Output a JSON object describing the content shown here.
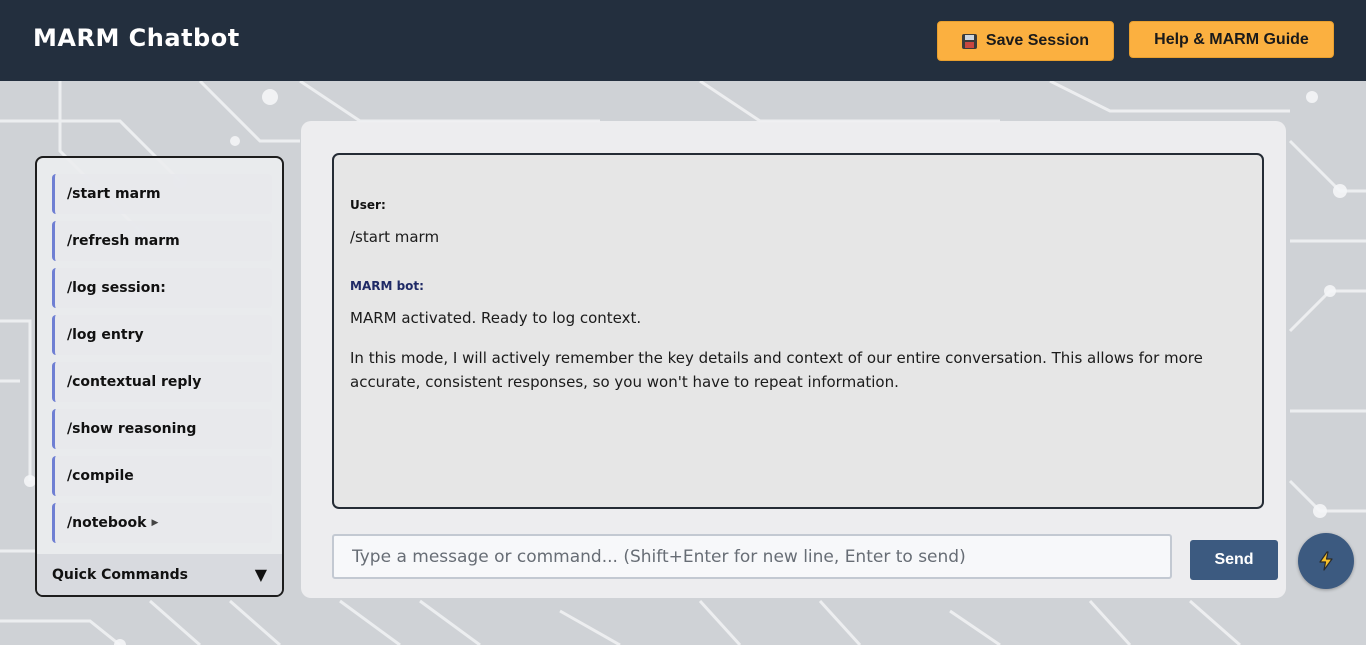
{
  "header": {
    "title": "MARM Chatbot",
    "save_label": "Save Session",
    "help_label": "Help & MARM Guide"
  },
  "sidebar": {
    "items": [
      {
        "label": "/start marm"
      },
      {
        "label": "/refresh marm"
      },
      {
        "label": "/log session:"
      },
      {
        "label": "/log entry"
      },
      {
        "label": "/contextual reply"
      },
      {
        "label": "/show reasoning"
      },
      {
        "label": "/compile"
      },
      {
        "label": "/notebook"
      }
    ],
    "quick_label": "Quick Commands",
    "quick_arrow": "▼",
    "notebook_arrow": "▶"
  },
  "chat": {
    "messages": [
      {
        "sender": "User:",
        "lines": [
          "/start marm"
        ]
      },
      {
        "sender": "MARM bot:",
        "lines": [
          "MARM activated. Ready to log context.",
          "In this mode, I will actively remember the key details and context of our entire conversation. This allows for more accurate, consistent responses, so you won't have to repeat information."
        ]
      }
    ]
  },
  "input": {
    "placeholder": "Type a message or command... (Shift+Enter for new line, Enter to send)",
    "value": ""
  },
  "send_label": "Send",
  "icons": {
    "save": "floppy-disk-icon",
    "fab": "lightning-icon"
  },
  "colors": {
    "header_bg": "#232f3e",
    "accent_yellow": "#fbb040",
    "send_blue": "#3c5a80",
    "sidebar_accent": "#6f7fd3"
  }
}
